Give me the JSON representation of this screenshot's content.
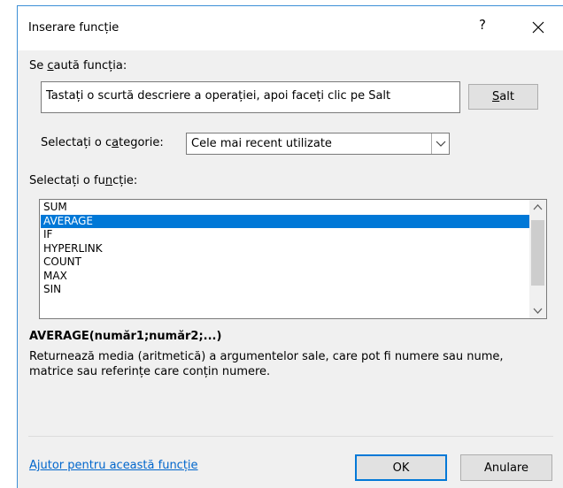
{
  "dialog": {
    "title": "Inserare funcție",
    "help_symbol": "?",
    "close_icon": "close-icon"
  },
  "search": {
    "label_pre": "Se ",
    "label_key": "c",
    "label_post": "aută funcția:",
    "value": "Tastați o scurtă descriere a operației, apoi faceți clic pe Salt",
    "go_label_key": "S",
    "go_label_rest": "alt"
  },
  "category": {
    "label_pre": "Selectați o c",
    "label_key": "a",
    "label_post": "tegorie:",
    "selected": "Cele mai recent utilizate",
    "arrow_icon": "chevron-down-icon"
  },
  "functions": {
    "label_pre": "Selectați o fu",
    "label_key": "n",
    "label_post": "cție:",
    "items": [
      "SUM",
      "AVERAGE",
      "IF",
      "HYPERLINK",
      "COUNT",
      "MAX",
      "SIN"
    ],
    "selected_index": 1
  },
  "details": {
    "signature": "AVERAGE(număr1;număr2;...)",
    "description": "Returnează media (aritmetică) a argumentelor sale, care pot fi numere sau nume, matrice sau referințe care conțin numere."
  },
  "footer": {
    "help_link": "Ajutor pentru această funcție",
    "ok_label": "OK",
    "cancel_label": "Anulare"
  },
  "colors": {
    "accent": "#0078d7",
    "link": "#0066cc",
    "window_border": "#3c8fd6"
  }
}
